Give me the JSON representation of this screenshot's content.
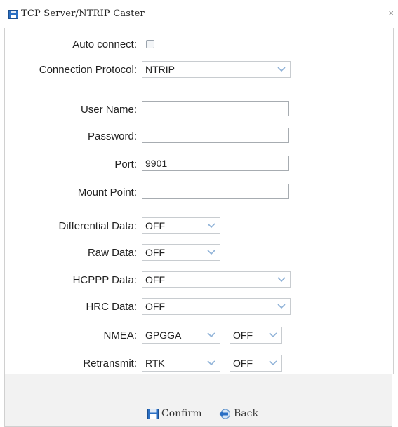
{
  "window": {
    "title": "TCP Server/NTRIP Caster",
    "close_glyph": "×"
  },
  "form": {
    "auto_connect": {
      "label": "Auto connect:",
      "checked": false
    },
    "protocol": {
      "label": "Connection Protocol:",
      "value": "NTRIP"
    },
    "user_name": {
      "label": "User Name:",
      "value": ""
    },
    "password": {
      "label": "Password:",
      "value": ""
    },
    "port": {
      "label": "Port:",
      "value": "9901"
    },
    "mount_point": {
      "label": "Mount Point:",
      "value": ""
    },
    "differential_data": {
      "label": "Differential Data:",
      "value": "OFF"
    },
    "raw_data": {
      "label": "Raw Data:",
      "value": "OFF"
    },
    "hcppp_data": {
      "label": "HCPPP Data:",
      "value": "OFF"
    },
    "hrc_data": {
      "label": "HRC Data:",
      "value": "OFF"
    },
    "nmea": {
      "label": "NMEA:",
      "type_value": "GPGGA",
      "rate_value": "OFF"
    },
    "retransmit": {
      "label": "Retransmit:",
      "type_value": "RTK",
      "rate_value": "OFF"
    }
  },
  "footer": {
    "confirm_label": "Confirm",
    "back_label": "Back"
  },
  "icons": {
    "window": "floppy-disk-icon",
    "confirm": "floppy-disk-icon",
    "back": "back-arrow-icon",
    "dropdown": "chevron-down-icon"
  },
  "colors": {
    "accent": "#2a6fc4",
    "chevron": "#8fb2d8",
    "footer_bg": "#f2f2f2"
  }
}
